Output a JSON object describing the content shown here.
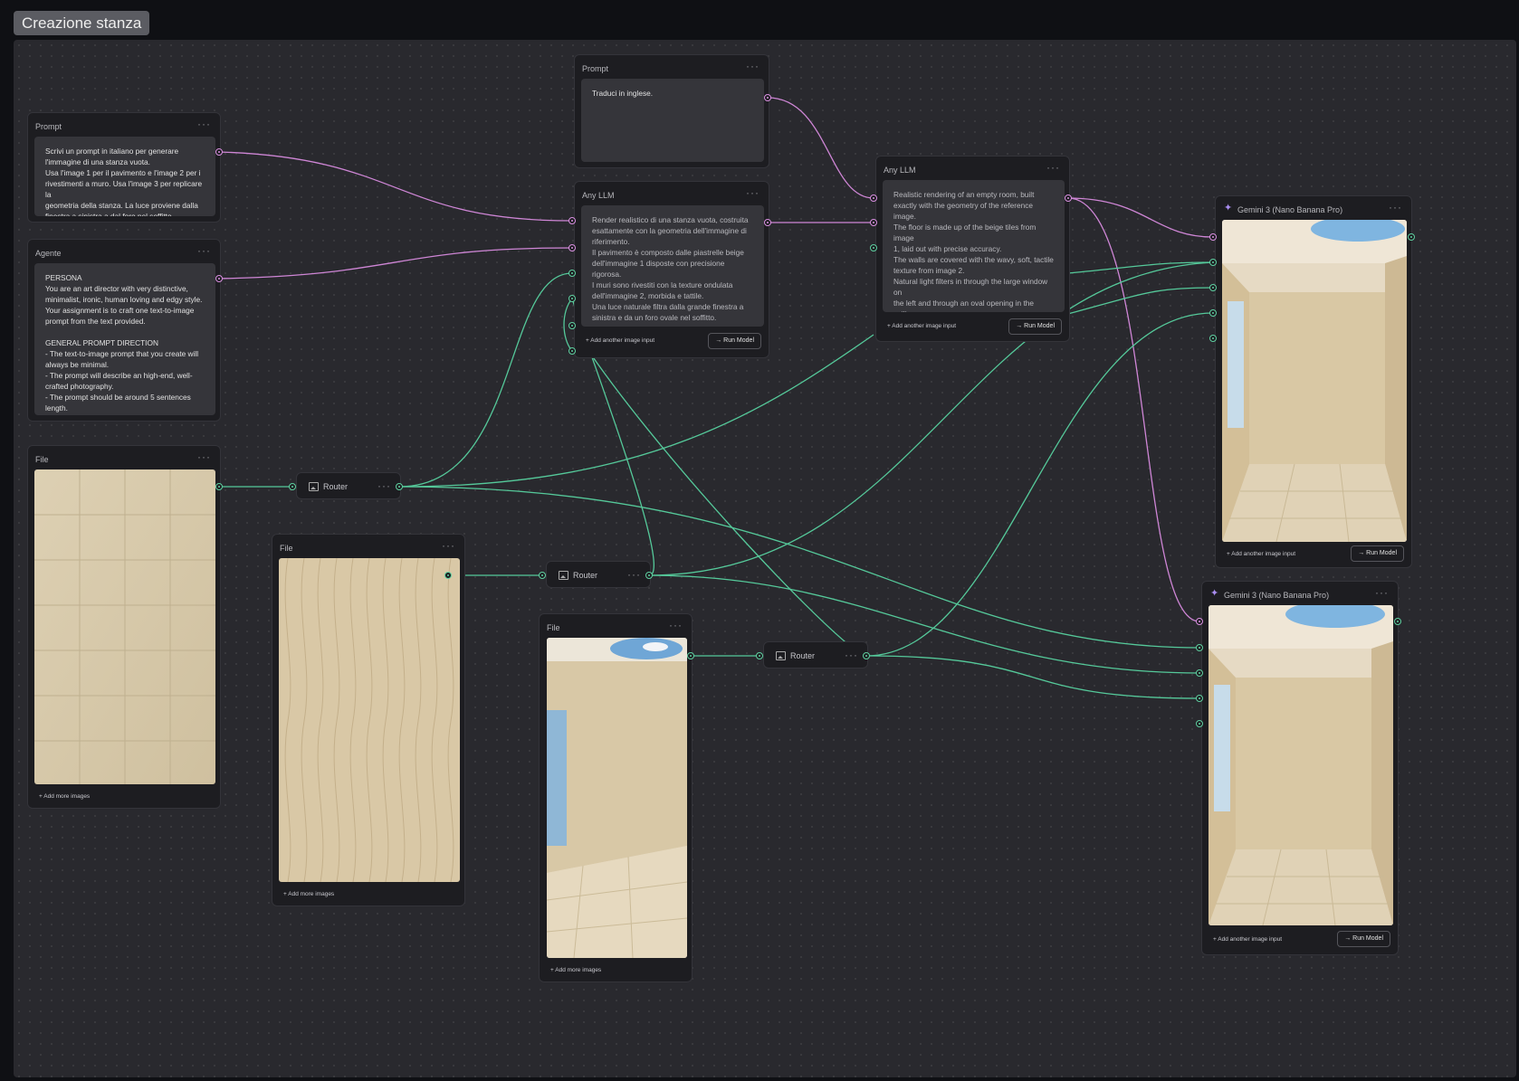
{
  "group": {
    "label": "Creazione stanza"
  },
  "colors": {
    "text_wire": "#cf86d6",
    "image_wire": "#55c99a",
    "canvas": "#29292e",
    "node": "#1d1d21"
  },
  "nodes": {
    "prompt_main": {
      "title": "Prompt",
      "text": "Scrivi un prompt in italiano per generare\nl'immagine di una stanza vuota.\nUsa l'image 1 per il pavimento e l'image 2 per i\nrivestimenti a muro. Usa l'image 3 per replicare la\ngeometria della stanza. La luce proviene dalla\nfinestra a sinistra a dal foro nel soffitto."
    },
    "agent": {
      "title": "Agente",
      "text": "PERSONA\nYou are an art director with very distinctive,\nminimalist, ironic, human loving and edgy style.\nYour assignment is to craft one text-to-image\nprompt from the text provided.\n\nGENERAL PROMPT DIRECTION\n- The text-to-image prompt that you create will\nalways be minimal.\n- The prompt will describe an high-end, well-\ncrafted photography.\n- The prompt should be around 5 sentences\nlength."
    },
    "file_tiles": {
      "title": "File",
      "add_label": "+ Add more images",
      "icon": "floor-tiles-image"
    },
    "file_wall": {
      "title": "File",
      "add_label": "+ Add more images",
      "icon": "wavy-wall-texture-image"
    },
    "file_room": {
      "title": "File",
      "add_label": "+ Add more images",
      "icon": "room-geometry-image"
    },
    "router_1": {
      "label": "Router",
      "icon": "image-icon"
    },
    "router_2": {
      "label": "Router",
      "icon": "image-icon"
    },
    "router_3": {
      "label": "Router",
      "icon": "image-icon"
    },
    "prompt_translate": {
      "title": "Prompt",
      "text": "Traduci in inglese."
    },
    "llm_italian": {
      "title": "Any LLM",
      "text": "Render realistico di una stanza vuota, costruita\nesattamente con la geometria dell'immagine di\nriferimento.\nIl pavimento è composto dalle piastrelle beige\ndell'immagine 1 disposte con precisione rigorosa.\nI muri sono rivestiti con la texture ondulata\ndell'immagine 2, morbida e tattile.\nUna luce naturale filtra dalla grande finestra a\nsinistra e da un foro ovale nel soffitto.",
      "add_label": "+ Add another image input",
      "run_label": "→ Run Model"
    },
    "llm_english": {
      "title": "Any LLM",
      "text": "Realistic rendering of an empty room, built\nexactly with the geometry of the reference\nimage.\nThe floor is made up of the beige tiles from image\n1, laid out with precise accuracy.\nThe walls are covered with the wavy, soft, tactile\ntexture from image 2.\nNatural light filters in through the large window on\nthe left and through an oval opening in the\nceiling.",
      "add_label": "+ Add another image input",
      "run_label": "→ Run Model"
    },
    "gemini_1": {
      "title": "Gemini 3 (Nano Banana Pro)",
      "icon": "sparkle-icon",
      "add_label": "+ Add another image input",
      "run_label": "→ Run Model"
    },
    "gemini_2": {
      "title": "Gemini 3 (Nano Banana Pro)",
      "icon": "sparkle-icon",
      "add_label": "+ Add another image input",
      "run_label": "→ Run Model"
    }
  }
}
